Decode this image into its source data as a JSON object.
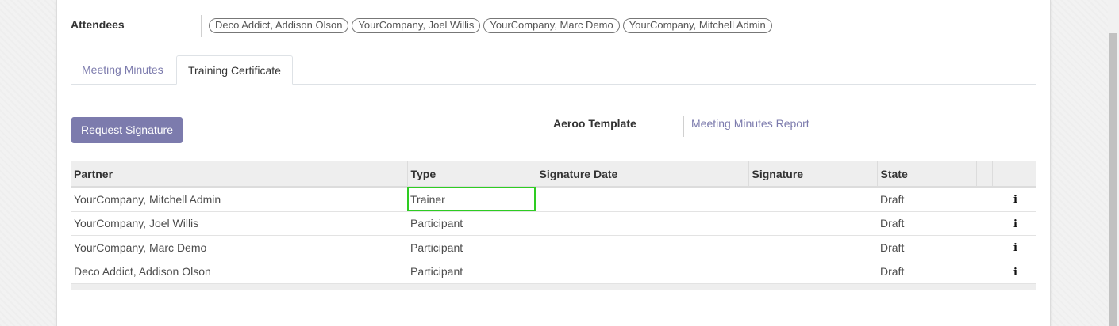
{
  "attendees": {
    "label": "Attendees",
    "tags": [
      "Deco Addict, Addison Olson",
      "YourCompany, Joel Willis",
      "YourCompany, Marc Demo",
      "YourCompany, Mitchell Admin"
    ]
  },
  "tabs": [
    {
      "label": "Meeting Minutes",
      "active": false
    },
    {
      "label": "Training Certificate",
      "active": true
    }
  ],
  "actions": {
    "request_signature_label": "Request Signature"
  },
  "aeroo": {
    "label": "Aeroo Template",
    "value": "Meeting Minutes Report"
  },
  "table": {
    "headers": [
      "Partner",
      "Type",
      "Signature Date",
      "Signature",
      "State",
      "",
      ""
    ],
    "rows": [
      {
        "partner": "YourCompany, Mitchell Admin",
        "type": "Trainer",
        "signature_date": "",
        "signature": "",
        "state": "Draft"
      },
      {
        "partner": "YourCompany, Joel Willis",
        "type": "Participant",
        "signature_date": "",
        "signature": "",
        "state": "Draft"
      },
      {
        "partner": "YourCompany, Marc Demo",
        "type": "Participant",
        "signature_date": "",
        "signature": "",
        "state": "Draft"
      },
      {
        "partner": "Deco Addict, Addison Olson",
        "type": "Participant",
        "signature_date": "",
        "signature": "",
        "state": "Draft"
      }
    ],
    "info_glyph": "i"
  },
  "colors": {
    "accent": "#7c7bad",
    "selection_outline": "#2ecc22"
  },
  "icons": {
    "row_info": "info-icon"
  }
}
